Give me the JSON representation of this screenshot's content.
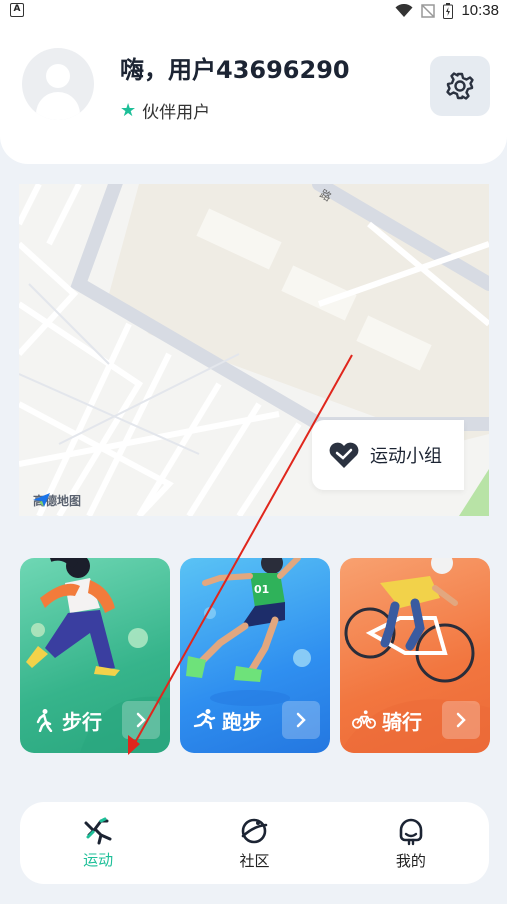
{
  "status_bar": {
    "left_icon": "A",
    "time": "10:38",
    "icons": [
      "wifi-icon",
      "signal-off-icon",
      "battery-icon"
    ]
  },
  "header": {
    "greeting": "嗨，用户43696290",
    "member_label": "伙伴用户",
    "member_icon": "star-icon",
    "settings_icon": "gear-icon"
  },
  "map": {
    "logo_text": "高德地图",
    "road_label": "路",
    "group_button_label": "运动小组",
    "group_button_icon": "heart-icon"
  },
  "activities": [
    {
      "label": "步行",
      "icon": "walk-icon",
      "color": "#36b48b"
    },
    {
      "label": "跑步",
      "icon": "run-icon",
      "color": "#2f8ff0"
    },
    {
      "label": "骑行",
      "icon": "bike-icon",
      "color": "#f2763f"
    }
  ],
  "nav": {
    "items": [
      {
        "label": "运动",
        "icon": "sport-icon",
        "active": true
      },
      {
        "label": "社区",
        "icon": "planet-icon",
        "active": false
      },
      {
        "label": "我的",
        "icon": "face-icon",
        "active": false
      }
    ]
  },
  "colors": {
    "accent": "#1dbf98",
    "background": "#eef2f7"
  }
}
